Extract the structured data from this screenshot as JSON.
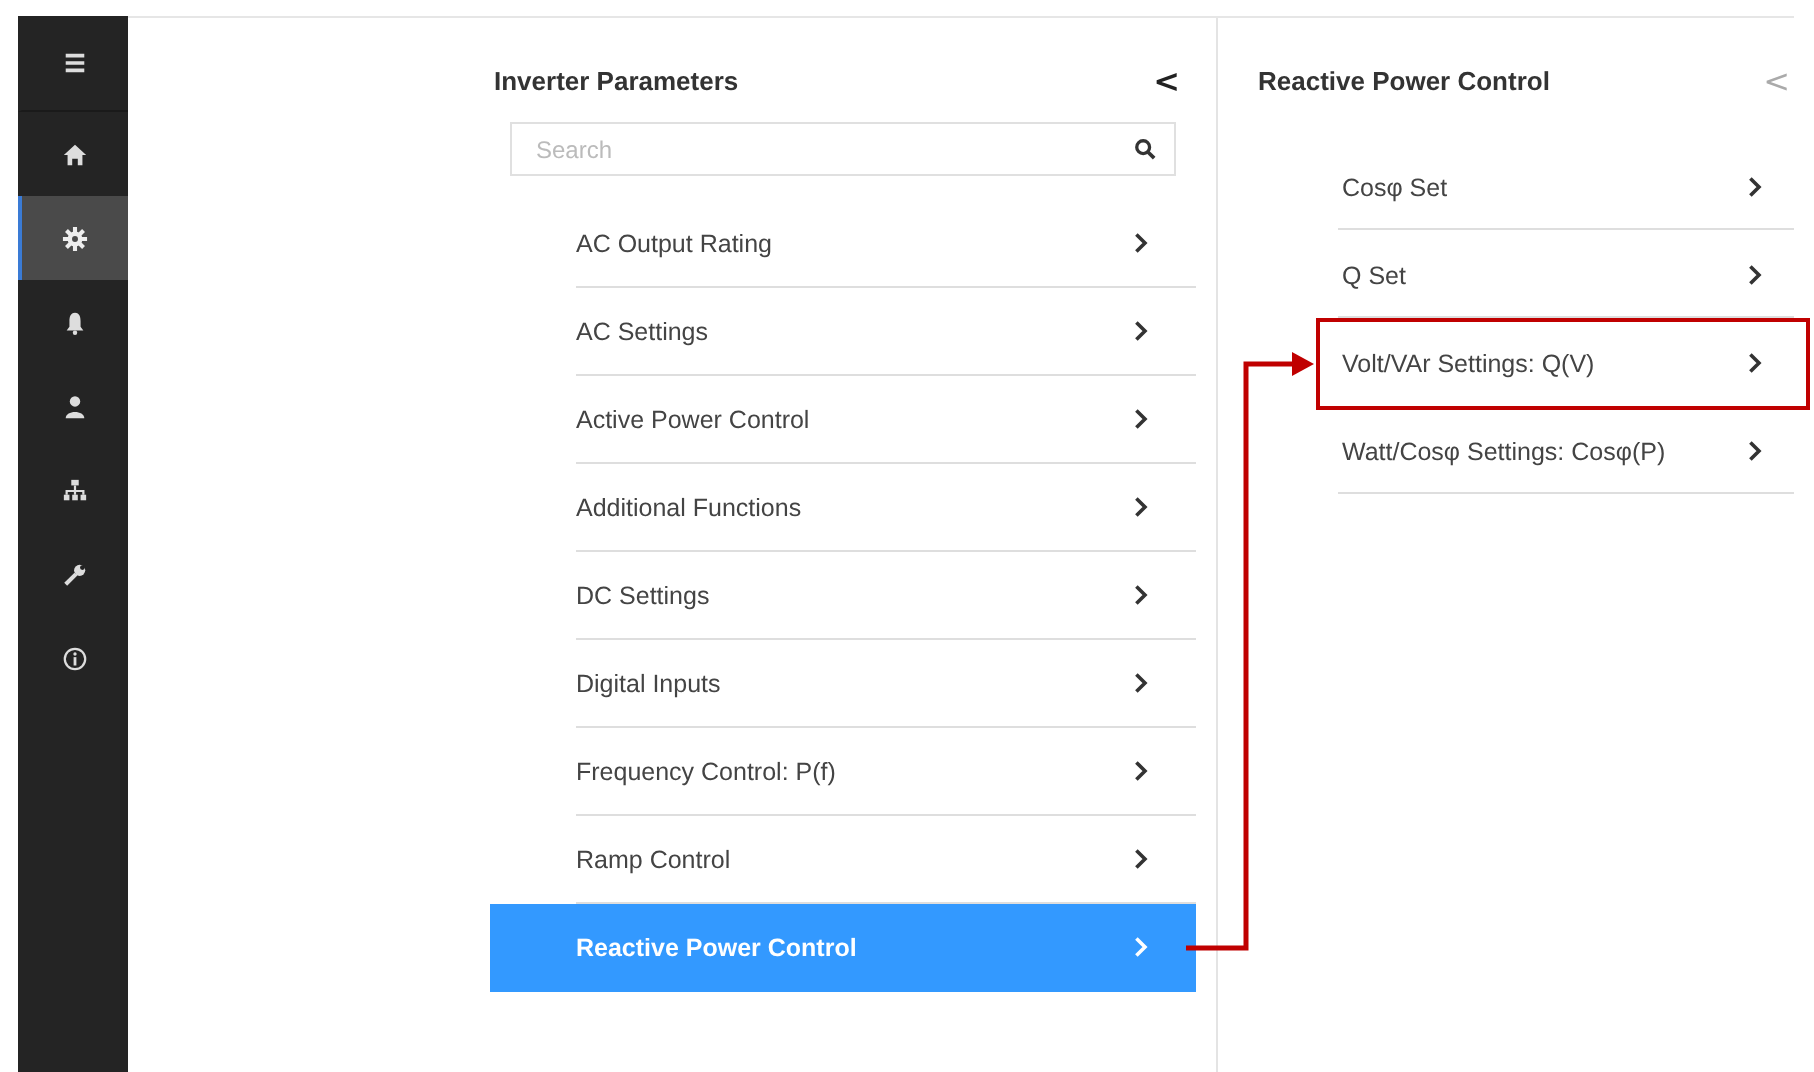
{
  "sidebar": {
    "items": [
      {
        "kind": "menu",
        "selected": false
      },
      {
        "kind": "home",
        "selected": false
      },
      {
        "kind": "gear",
        "selected": true
      },
      {
        "kind": "bell",
        "selected": false
      },
      {
        "kind": "person",
        "selected": false
      },
      {
        "kind": "sitemap",
        "selected": false
      },
      {
        "kind": "wrench",
        "selected": false
      },
      {
        "kind": "info",
        "selected": false
      }
    ]
  },
  "parameters_panel": {
    "title": "Inverter Parameters",
    "collapse": "<",
    "search": {
      "placeholder": "Search"
    },
    "items": [
      {
        "label": "AC Output Rating",
        "selected": false
      },
      {
        "label": "AC Settings",
        "selected": false
      },
      {
        "label": "Active Power Control",
        "selected": false
      },
      {
        "label": "Additional Functions",
        "selected": false
      },
      {
        "label": "DC Settings",
        "selected": false
      },
      {
        "label": "Digital Inputs",
        "selected": false
      },
      {
        "label": "Frequency Control: P(f)",
        "selected": false
      },
      {
        "label": "Ramp Control",
        "selected": false
      },
      {
        "label": "Reactive Power Control",
        "selected": true
      }
    ]
  },
  "detail_panel": {
    "title": "Reactive Power Control",
    "collapse": "<",
    "items": [
      {
        "label": "Cosφ Set",
        "highlighted": false
      },
      {
        "label": "Q Set",
        "highlighted": false
      },
      {
        "label": "Volt/VAr Settings: Q(V)",
        "highlighted": true
      },
      {
        "label": "Watt/Cosφ Settings: Cosφ(P)",
        "highlighted": false
      }
    ]
  }
}
